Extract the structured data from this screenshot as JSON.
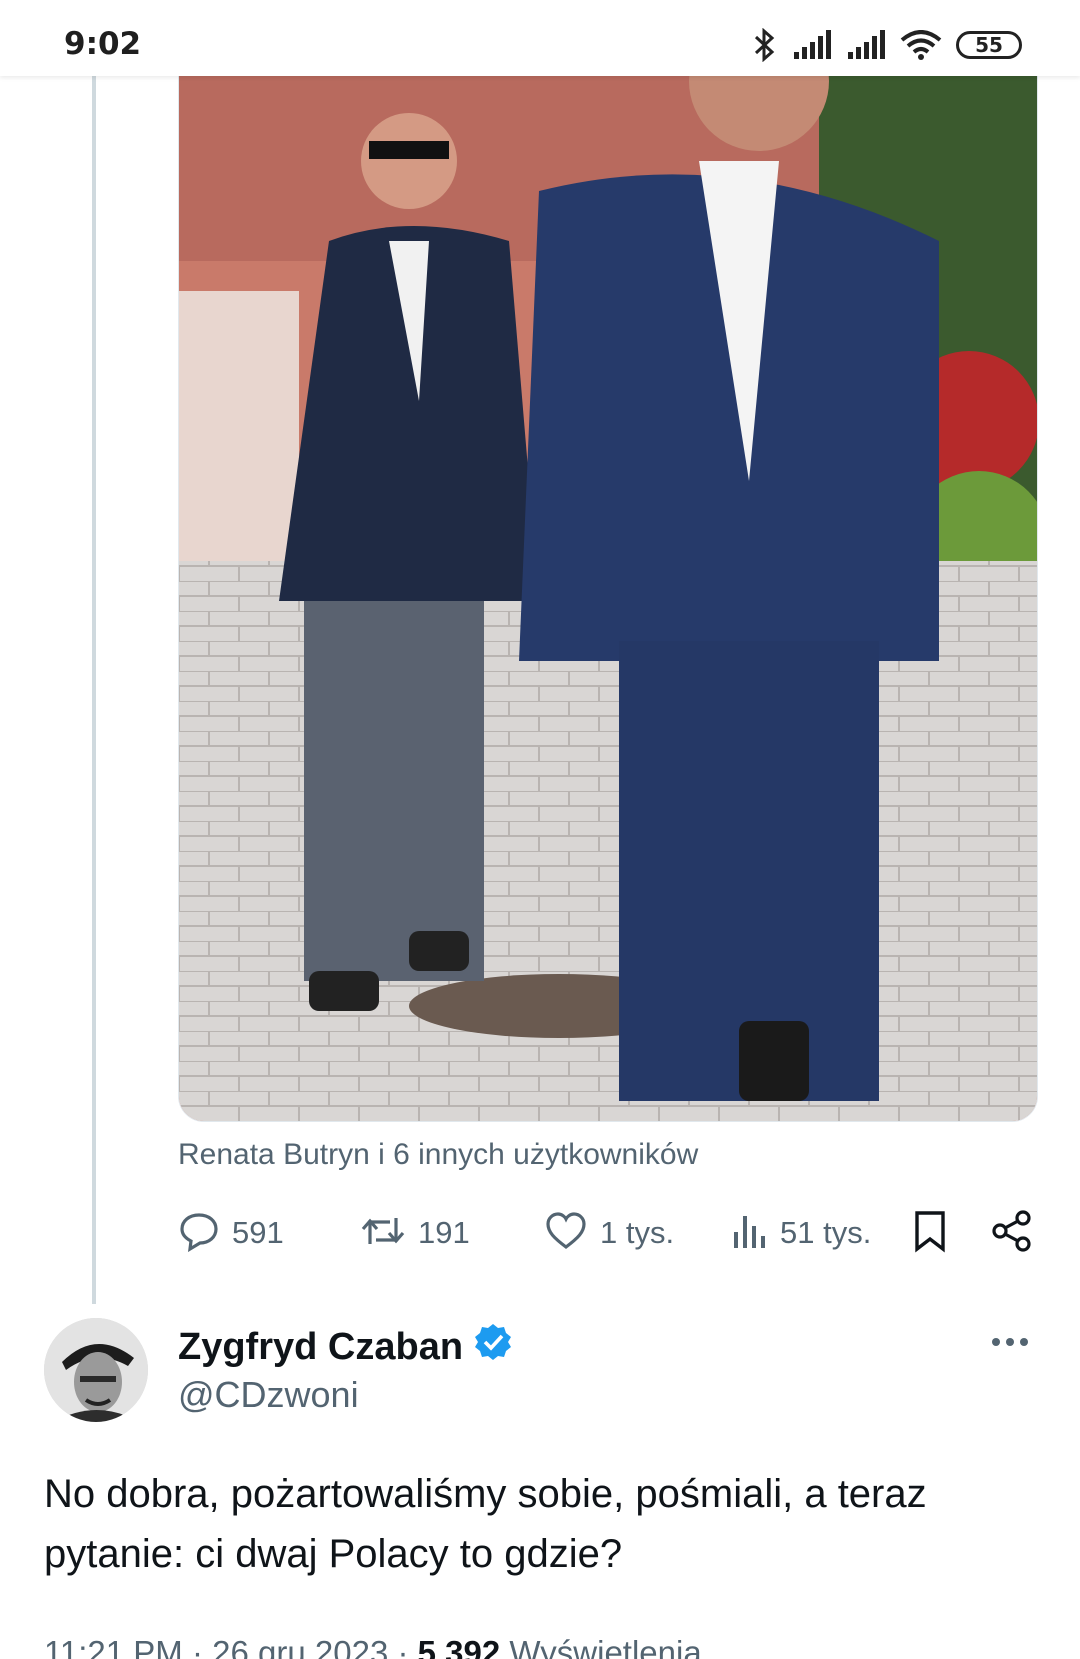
{
  "status_bar": {
    "time": "9:02",
    "battery": "55",
    "icons": [
      "bluetooth-icon",
      "signal-icon",
      "signal-icon",
      "wifi-icon",
      "battery-icon"
    ]
  },
  "quoted_tweet": {
    "image_alt": "photo",
    "tagged_users": "Renata Butryn i 6 innych użytkowników",
    "actions": {
      "replies": "591",
      "retweets": "191",
      "likes": "1 tys.",
      "views": "51 tys."
    }
  },
  "tweet": {
    "author_name": "Zygfryd Czaban",
    "author_handle": "@CDzwoni",
    "verified": true,
    "text": "No dobra, pożartowaliśmy sobie, pośmiali, a teraz pytanie: ci dwaj Polacy to gdzie?",
    "time": "11:21 PM",
    "date": "26 gru 2023",
    "separator": "·",
    "views_count": "5 392",
    "views_label": "Wyświetlenia"
  },
  "colors": {
    "accent": "#1d9bf0",
    "secondary_text": "#536471",
    "thread_line": "#cfd9de"
  }
}
